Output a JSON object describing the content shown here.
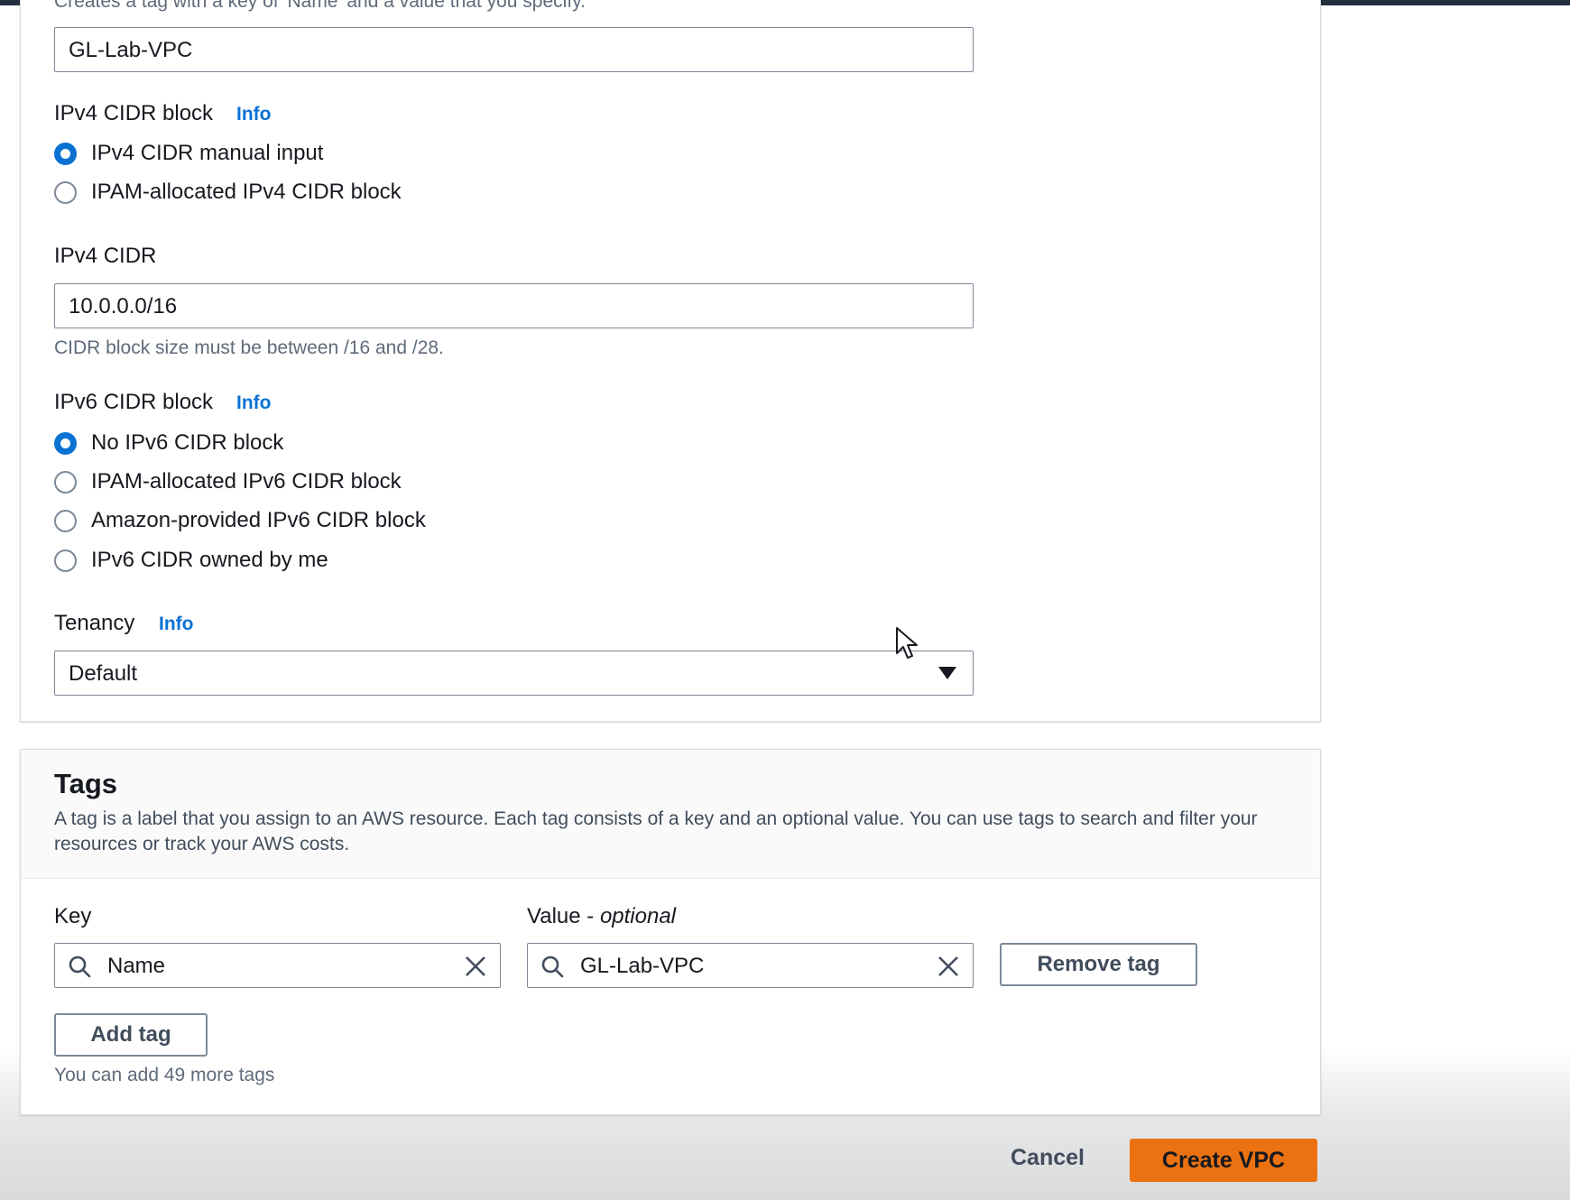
{
  "vpc_settings": {
    "name_hint_cut": "Creates a tag with a key of 'Name' and a value that you specify.",
    "name_value": "GL-Lab-VPC",
    "ipv4_block": {
      "label": "IPv4 CIDR block",
      "info": "Info",
      "options": [
        {
          "label": "IPv4 CIDR manual input",
          "checked": true
        },
        {
          "label": "IPAM-allocated IPv4 CIDR block",
          "checked": false
        }
      ]
    },
    "ipv4_cidr": {
      "label": "IPv4 CIDR",
      "value": "10.0.0.0/16",
      "hint": "CIDR block size must be between /16 and /28."
    },
    "ipv6_block": {
      "label": "IPv6 CIDR block",
      "info": "Info",
      "options": [
        {
          "label": "No IPv6 CIDR block",
          "checked": true
        },
        {
          "label": "IPAM-allocated IPv6 CIDR block",
          "checked": false
        },
        {
          "label": "Amazon-provided IPv6 CIDR block",
          "checked": false
        },
        {
          "label": "IPv6 CIDR owned by me",
          "checked": false
        }
      ]
    },
    "tenancy": {
      "label": "Tenancy",
      "info": "Info",
      "selected": "Default"
    }
  },
  "tags": {
    "title": "Tags",
    "description": "A tag is a label that you assign to an AWS resource. Each tag consists of a key and an optional value. You can use tags to search and filter your resources or track your AWS costs.",
    "key_label": "Key",
    "value_label_main": "Value - ",
    "value_label_optional": "optional",
    "rows": [
      {
        "key": "Name",
        "value": "GL-Lab-VPC"
      }
    ],
    "remove_button": "Remove tag",
    "add_button": "Add tag",
    "remaining_hint": "You can add 49 more tags"
  },
  "footer": {
    "cancel_label": "Cancel",
    "create_label": "Create VPC"
  },
  "colors": {
    "accent_link": "#0972d3",
    "primary_button": "#ec7211"
  }
}
